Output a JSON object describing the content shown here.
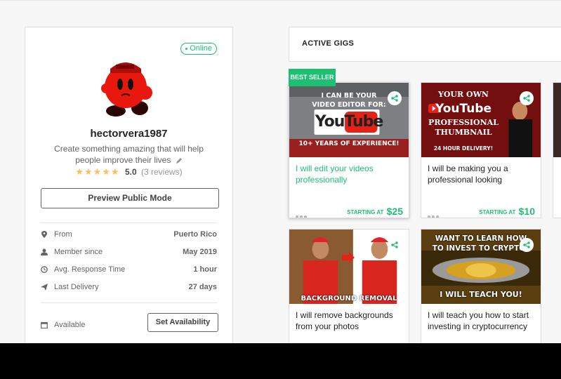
{
  "profile": {
    "status": "Online",
    "username": "hectorvera1987",
    "tagline": "Create something amazing that will help people improve their lives",
    "rating_score": "5.0",
    "rating_reviews": "(3 reviews)",
    "stars": "★★★★★",
    "preview_label": "Preview Public Mode",
    "stats": [
      {
        "label": "From",
        "value": "Puerto Rico",
        "icon": "location-pin-icon"
      },
      {
        "label": "Member since",
        "value": "May 2019",
        "icon": "user-icon"
      },
      {
        "label": "Avg. Response Time",
        "value": "1 hour",
        "icon": "clock-icon"
      },
      {
        "label": "Last Delivery",
        "value": "27 days",
        "icon": "send-icon"
      }
    ],
    "availability_label": "Available",
    "availability_button": "Set Availability"
  },
  "gigs": {
    "heading": "ACTIVE GIGS",
    "best_seller": "BEST SELLER",
    "starting_at": "STARTING AT",
    "items": [
      {
        "title": "I will edit your videos professionally",
        "price": "$25",
        "thumb_lines": [
          "I CAN BE YOUR",
          "VIDEO EDITOR FOR:",
          "YouTube",
          "10+ YEARS OF EXPERIENCE!"
        ]
      },
      {
        "title": "I will be making you a professional looking",
        "price": "$10",
        "thumb_lines": [
          "YOUR OWN",
          "YouTube",
          "PROFESSIONAL",
          "THUMBNAIL",
          "24 HOUR DELIVERY!"
        ]
      },
      {
        "title": "I will remove backgrounds from your photos",
        "price": "",
        "thumb_lines": [
          "BACKGROUND REMOVAL"
        ]
      },
      {
        "title": "I will teach you how to start investing in cryptocurrency",
        "price": "",
        "thumb_lines": [
          "WANT TO LEARN HOW",
          "TO INVEST TO CRYPTO?",
          "I WILL TEACH YOU!"
        ]
      }
    ]
  },
  "colors": {
    "accent": "#1dbf73",
    "star": "#ffbe5b",
    "youtube_red": "#e62117"
  }
}
